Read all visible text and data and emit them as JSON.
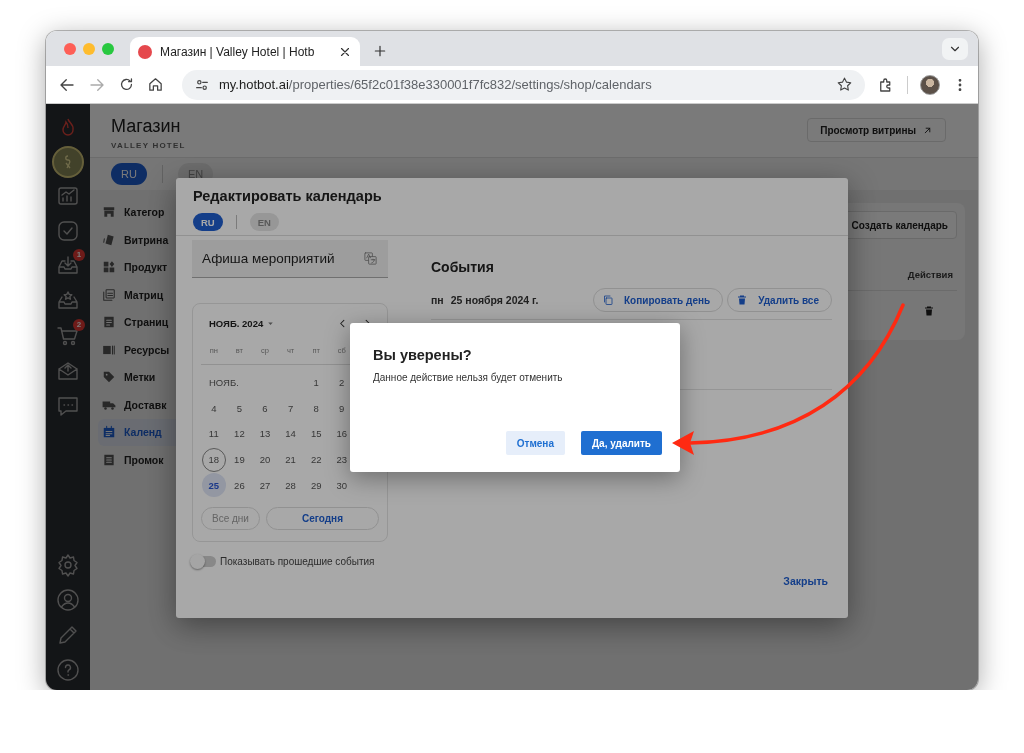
{
  "browser": {
    "tab_title": "Магазин | Valley Hotel | Hotb",
    "url_host": "my.hotbot.ai",
    "url_path": "/properties/65f2c01f38e330001f7fc832/settings/shop/calendars"
  },
  "rail": {
    "top": [
      {
        "kind": "chart"
      },
      {
        "kind": "checkmark"
      },
      {
        "kind": "inbox",
        "badge": "1"
      },
      {
        "kind": "star-tray"
      },
      {
        "kind": "cart",
        "badge": "2"
      },
      {
        "kind": "envelope"
      },
      {
        "kind": "chat"
      }
    ],
    "bottom": [
      {
        "kind": "settings"
      },
      {
        "kind": "user"
      },
      {
        "kind": "pencil"
      },
      {
        "kind": "help"
      }
    ]
  },
  "header": {
    "title": "Магазин",
    "subtitle": "VALLEY HOTEL",
    "preview_button": "Просмотр витрины"
  },
  "languages": [
    {
      "label": "RU",
      "selected": true
    },
    {
      "label": "EN",
      "selected": false
    }
  ],
  "nav": [
    {
      "kind": "store",
      "label": "Категор",
      "selected": false
    },
    {
      "kind": "cards",
      "label": "Витрина",
      "selected": false
    },
    {
      "kind": "grid",
      "label": "Продукт",
      "selected": false
    },
    {
      "kind": "stack",
      "label": "Матриц",
      "selected": false
    },
    {
      "kind": "document",
      "label": "Страниц",
      "selected": false
    },
    {
      "kind": "id-card",
      "label": "Ресурсы",
      "selected": false
    },
    {
      "kind": "tag",
      "label": "Метки",
      "selected": false
    },
    {
      "kind": "truck",
      "label": "Доставк",
      "selected": false
    },
    {
      "kind": "calendar",
      "label": "Календ",
      "selected": true
    },
    {
      "kind": "list",
      "label": "Промок",
      "selected": false
    }
  ],
  "calendars_card": {
    "create_button": "Создать календарь",
    "actions_column": "Действия"
  },
  "edit_modal": {
    "title": "Редактировать календарь",
    "languages": [
      {
        "label": "RU",
        "selected": true
      },
      {
        "label": "EN",
        "selected": false
      }
    ],
    "name_field": "Афиша мероприятий",
    "calendar": {
      "month_year": "НОЯБ. 2024",
      "weekdays": [
        "пн",
        "вт",
        "ср",
        "чт",
        "пт",
        "сб"
      ],
      "month_label": "НОЯБ.",
      "weeks": [
        {
          "days": [
            {
              "label": "1",
              "selected": false,
              "today": false
            },
            {
              "label": "2",
              "selected": false,
              "today": false
            }
          ]
        },
        {
          "days": [
            {
              "label": "4",
              "selected": false,
              "today": false
            },
            {
              "label": "5",
              "selected": false,
              "today": false
            },
            {
              "label": "6",
              "selected": false,
              "today": false
            },
            {
              "label": "7",
              "selected": false,
              "today": false
            },
            {
              "label": "8",
              "selected": false,
              "today": false
            },
            {
              "label": "9",
              "selected": false,
              "today": false
            }
          ]
        },
        {
          "days": [
            {
              "label": "11",
              "selected": false,
              "today": false
            },
            {
              "label": "12",
              "selected": false,
              "today": false
            },
            {
              "label": "13",
              "selected": false,
              "today": false
            },
            {
              "label": "14",
              "selected": false,
              "today": false
            },
            {
              "label": "15",
              "selected": false,
              "today": false
            },
            {
              "label": "16",
              "selected": false,
              "today": false
            }
          ]
        },
        {
          "days": [
            {
              "label": "18",
              "selected": false,
              "today": true
            },
            {
              "label": "19",
              "selected": false,
              "today": false
            },
            {
              "label": "20",
              "selected": false,
              "today": false
            },
            {
              "label": "21",
              "selected": false,
              "today": false
            },
            {
              "label": "22",
              "selected": false,
              "today": false
            },
            {
              "label": "23",
              "selected": false,
              "today": false
            }
          ]
        },
        {
          "days": [
            {
              "label": "25",
              "selected": true,
              "today": false
            },
            {
              "label": "26",
              "selected": false,
              "today": false
            },
            {
              "label": "27",
              "selected": false,
              "today": false
            },
            {
              "label": "28",
              "selected": false,
              "today": false
            },
            {
              "label": "29",
              "selected": false,
              "today": false
            },
            {
              "label": "30",
              "selected": false,
              "today": false
            }
          ]
        }
      ],
      "all_days_button": "Все дни",
      "today_button": "Сегодня"
    },
    "toggle": {
      "label": "Показывать прошедшие события",
      "on": false
    },
    "events_title": "События",
    "day": {
      "weekday": "пн",
      "date": "25 ноября 2024 г."
    },
    "day_actions": [
      {
        "kind": "copy",
        "label": "Копировать день"
      },
      {
        "kind": "delete",
        "label": "Удалить все"
      }
    ],
    "close_link": "Закрыть"
  },
  "confirm_dialog": {
    "title": "Вы уверены?",
    "message": "Данное действие нельзя будет отменить",
    "buttons": [
      {
        "kind": "secondary",
        "label": "Отмена"
      },
      {
        "kind": "primary",
        "label": "Да, удалить"
      }
    ]
  }
}
